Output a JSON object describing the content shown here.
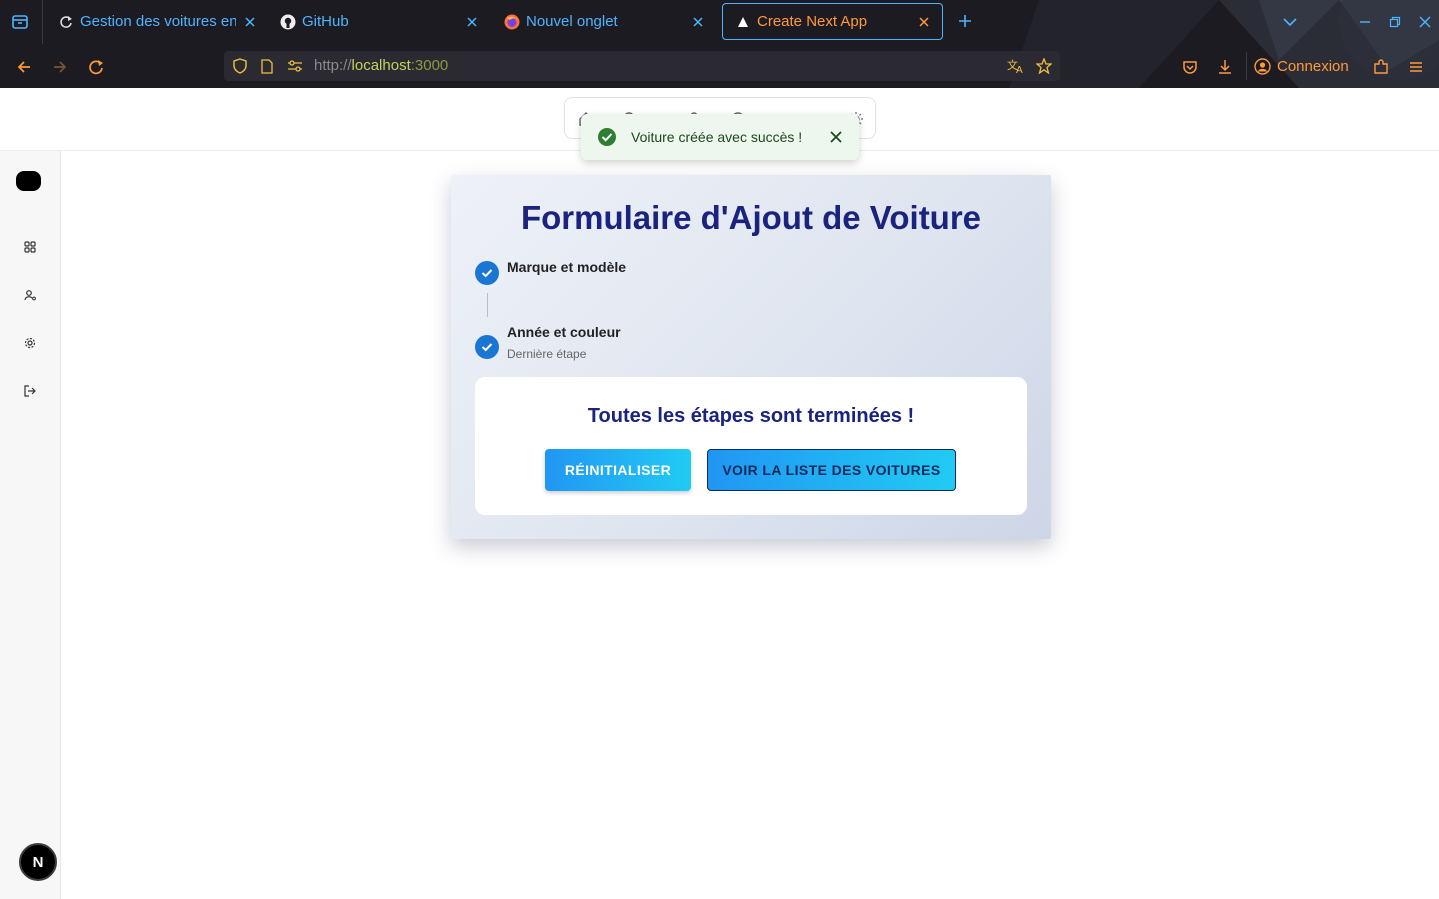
{
  "browser": {
    "tabs": [
      {
        "title": "Gestion des voitures en",
        "active": false
      },
      {
        "title": "GitHub",
        "active": false
      },
      {
        "title": "Nouvel onglet",
        "active": false
      },
      {
        "title": "Create Next App",
        "active": true
      }
    ],
    "url": {
      "scheme": "http://",
      "host": "localhost",
      "port": ":3000"
    },
    "signin_label": "Connexion",
    "colors": {
      "accent_blue": "#4fb4ff",
      "accent_orange": "#ff9a3c",
      "chrome_bg": "#1c1b22"
    }
  },
  "toast": {
    "message": "Voiture créée avec succès !",
    "icon": "check-circle-icon"
  },
  "sidebar": {
    "items": [
      {
        "icon": "grid-icon"
      },
      {
        "icon": "user-gear-icon"
      },
      {
        "icon": "settings-icon"
      },
      {
        "icon": "logout-icon"
      }
    ],
    "badge": "N"
  },
  "form": {
    "title": "Formulaire d'Ajout de Voiture",
    "steps": [
      {
        "label": "Marque et modèle",
        "completed": true
      },
      {
        "label": "Année et couleur",
        "sublabel": "Dernière étape",
        "completed": true
      }
    ],
    "complete_message": "Toutes les étapes sont terminées !",
    "reset_label": "RÉINITIALISER",
    "list_label": "VOIR LA LISTE DES VOITURES",
    "colors": {
      "title": "#1a237e",
      "step": "#1976d2",
      "button_from": "#2196f3",
      "button_to": "#21cbf3"
    }
  }
}
